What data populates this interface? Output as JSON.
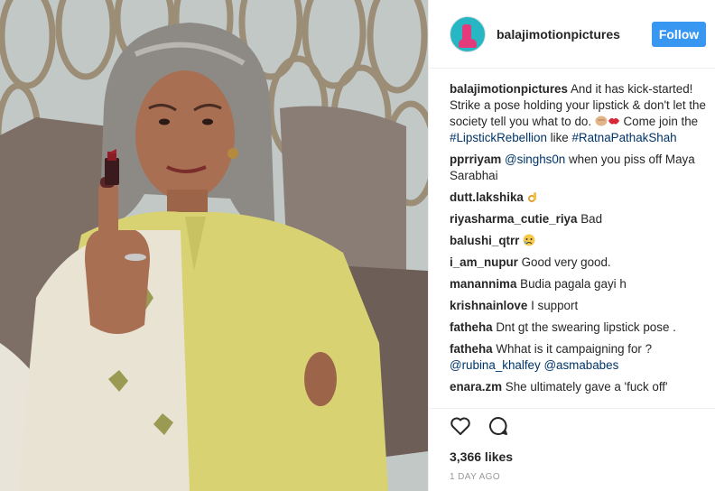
{
  "post": {
    "account": "balajimotionpictures",
    "follow_label": "Follow",
    "likes": "3,366 likes",
    "date": "1 day ago"
  },
  "caption": {
    "user": "balajimotionpictures",
    "text_1": "And it has kick-started! Strike a pose holding your lipstick & don't let the society tell you what to do. ",
    "text_2": " Come join the ",
    "tag_1": "#LipstickRebellion",
    "text_3": " like ",
    "tag_2": "#RatnaPathakShah"
  },
  "comments": [
    {
      "user": "pprriyam",
      "mention": "@singhs0n",
      "text": " when you piss off Maya Sarabhai"
    },
    {
      "user": "dutt.lakshika",
      "text": ""
    },
    {
      "user": "riyasharma_cutie_riya",
      "text": "Bad"
    },
    {
      "user": "balushi_qtrr",
      "text": ""
    },
    {
      "user": "i_am_nupur",
      "text": "Good very good."
    },
    {
      "user": "manannima",
      "text": "Budia pagala gayi h"
    },
    {
      "user": "krishnainlove",
      "text": "I support"
    },
    {
      "user": "fatheha",
      "text": "Dnt gt the swearing lipstick pose ."
    },
    {
      "user": "fatheha",
      "text": "Whhat is it campaigning for ?",
      "mention_1": "@rubina_khalfey",
      "mention_2": "@asmababes"
    },
    {
      "user": "enara.zm",
      "text": "She ultimately gave a 'fuck off'"
    }
  ],
  "icons": {
    "like": "heart-icon",
    "comment": "speech-bubble-icon"
  },
  "colors": {
    "follow_button": "#3897f0",
    "hashtag": "#003569",
    "date": "#999999"
  }
}
